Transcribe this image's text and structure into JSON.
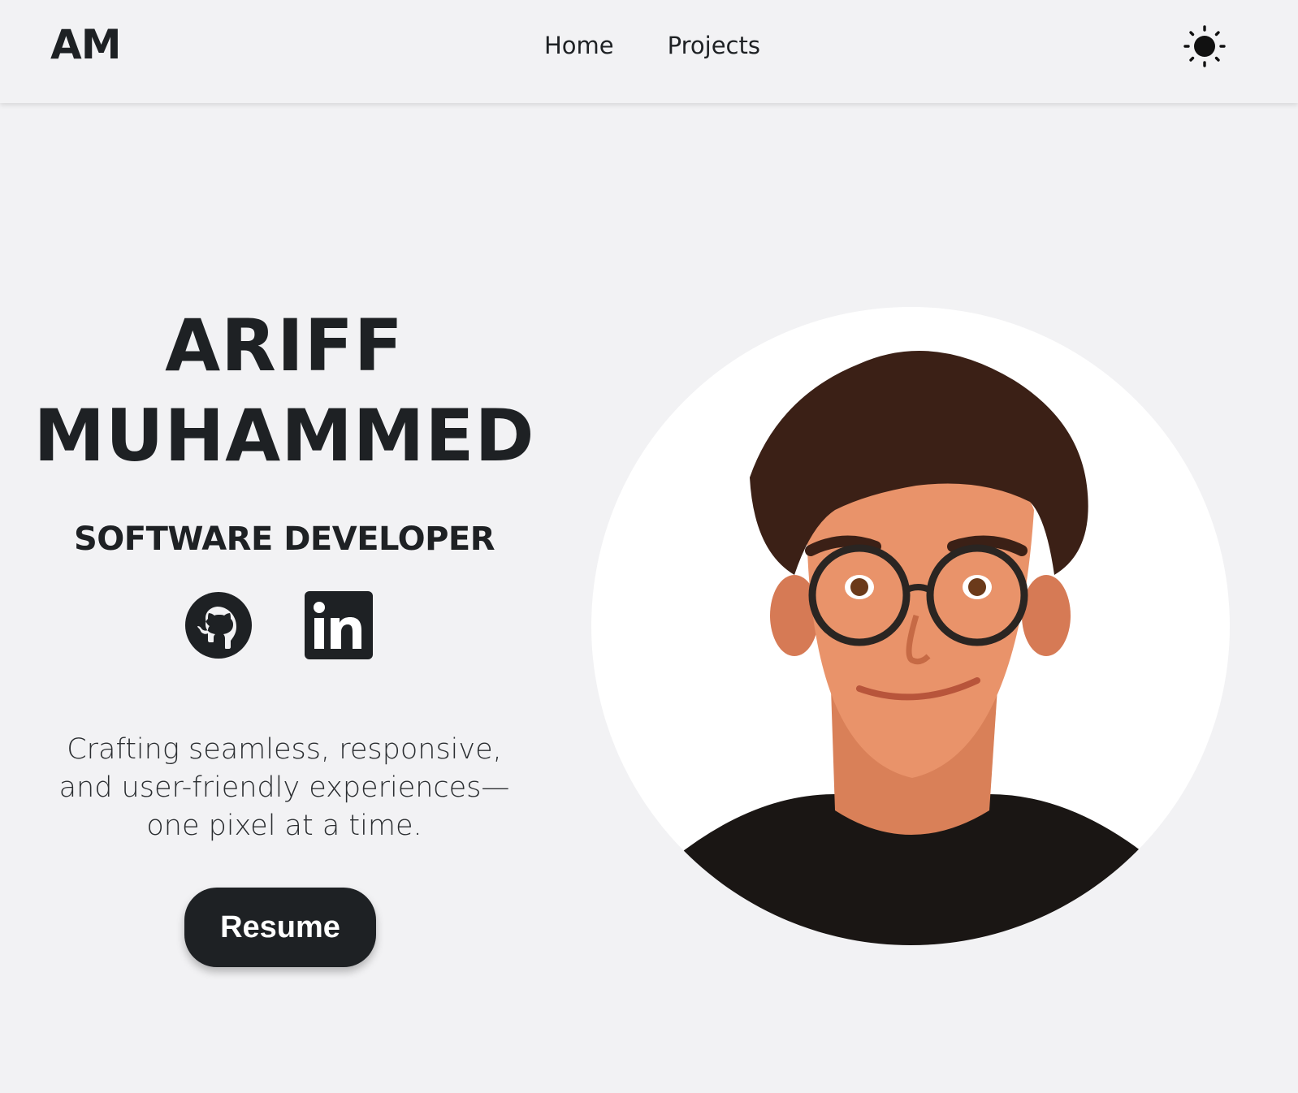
{
  "header": {
    "logo": "AM",
    "nav": [
      {
        "label": "Home"
      },
      {
        "label": "Projects"
      }
    ],
    "theme_toggle_icon": "sun-icon"
  },
  "hero": {
    "name_line1": "ARIFF",
    "name_line2": "MUHAMMED",
    "role": "SOFTWARE DEVELOPER",
    "socials": [
      {
        "icon": "github-icon"
      },
      {
        "icon": "linkedin-icon"
      }
    ],
    "tagline": "Crafting seamless, responsive, and user-friendly experiences—one pixel at a time.",
    "resume_label": "Resume"
  },
  "colors": {
    "background": "#f2f2f4",
    "text": "#1e2124",
    "button_bg": "#1e2124",
    "button_text": "#ffffff",
    "avatar_bg": "#ffffff"
  }
}
